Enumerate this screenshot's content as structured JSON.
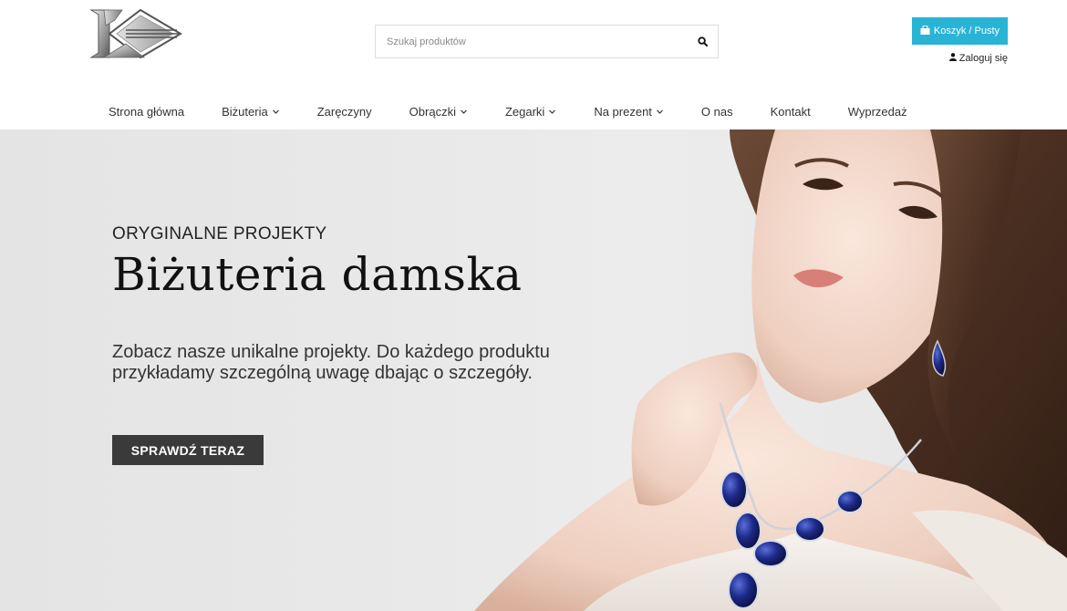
{
  "search": {
    "placeholder": "Szukaj produktów",
    "icon": "search-icon"
  },
  "cart": {
    "label": "Koszyk / Pusty",
    "icon": "shopping-bag-icon",
    "color": "#29b4d6"
  },
  "account": {
    "label": "Zaloguj się",
    "icon": "user-icon"
  },
  "nav": {
    "items": [
      {
        "label": "Strona główna",
        "has_dropdown": false
      },
      {
        "label": "Biżuteria",
        "has_dropdown": true
      },
      {
        "label": "Zaręczyny",
        "has_dropdown": false
      },
      {
        "label": "Obrączki",
        "has_dropdown": true
      },
      {
        "label": "Zegarki",
        "has_dropdown": true
      },
      {
        "label": "Na prezent",
        "has_dropdown": true
      },
      {
        "label": "O nas",
        "has_dropdown": false
      },
      {
        "label": "Kontakt",
        "has_dropdown": false
      },
      {
        "label": "Wyprzedaż",
        "has_dropdown": false
      }
    ]
  },
  "hero": {
    "subtitle": "ORYGINALNE PROJEKTY",
    "title": "Biżuteria damska",
    "description": "Zobacz nasze unikalne projekty. Do każdego produktu przykładamy szczególną uwagę dbając o szczegóły.",
    "button_label": "SPRAWDŹ TERAZ",
    "button_color": "#3a3a3a"
  }
}
